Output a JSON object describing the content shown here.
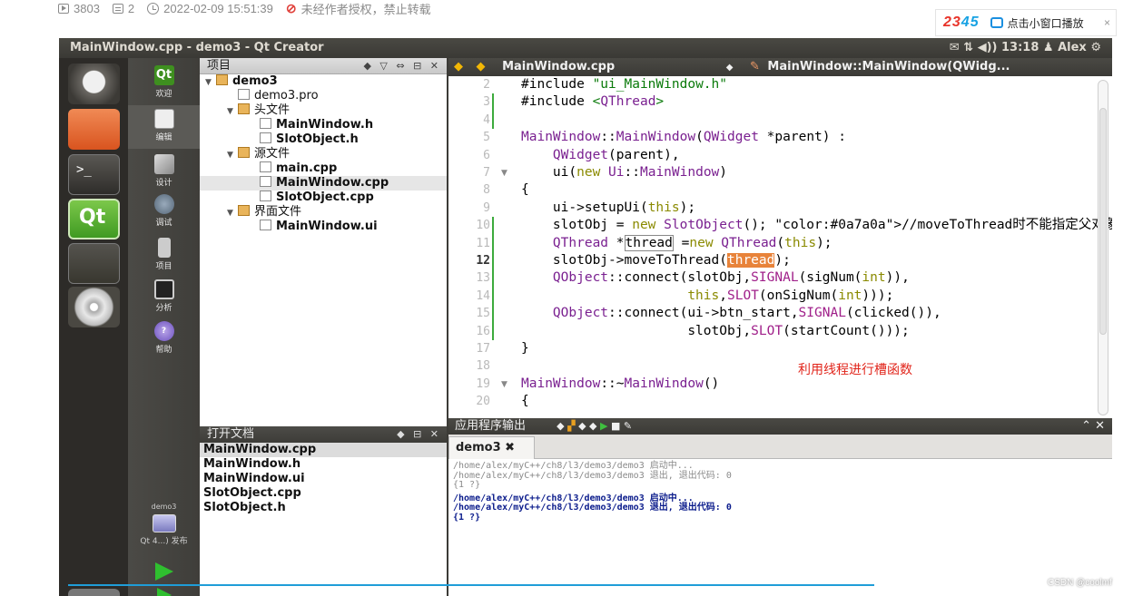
{
  "meta": {
    "views": "3803",
    "comments": "2",
    "datetime": "2022-02-09 15:51:39",
    "notice": "未经作者授权，禁止转载"
  },
  "ad": {
    "brand_a": "23",
    "brand_b": "45",
    "label": "点击小窗口播放",
    "close": "×"
  },
  "window": {
    "title": "MainWindow.cpp - demo3 - Qt Creator",
    "indicators": "✉ ⇅ ◀)) 13:18 ♟ Alex ⚙"
  },
  "sidebar": {
    "items": [
      {
        "label": "欢迎"
      },
      {
        "label": "编辑"
      },
      {
        "label": "设计"
      },
      {
        "label": "调试"
      },
      {
        "label": "项目"
      },
      {
        "label": "分析"
      },
      {
        "label": "帮助"
      }
    ],
    "kit": "demo3",
    "kit_target": "Qt 4...) 发布"
  },
  "project": {
    "header": "项目",
    "tree": [
      {
        "text": "demo3",
        "bold": true,
        "indent": 0,
        "arrow": "▼"
      },
      {
        "text": "demo3.pro",
        "indent": 1
      },
      {
        "text": "头文件",
        "indent": 1,
        "arrow": "▼"
      },
      {
        "text": "MainWindow.h",
        "indent": 2
      },
      {
        "text": "SlotObject.h",
        "indent": 2
      },
      {
        "text": "源文件",
        "indent": 1,
        "arrow": "▼"
      },
      {
        "text": "main.cpp",
        "indent": 2
      },
      {
        "text": "MainWindow.cpp",
        "indent": 2,
        "selected": true
      },
      {
        "text": "SlotObject.cpp",
        "indent": 2
      },
      {
        "text": "界面文件",
        "indent": 1,
        "arrow": "▼"
      },
      {
        "text": "MainWindow.ui",
        "indent": 2
      }
    ]
  },
  "open_docs": {
    "header": "打开文档",
    "files": [
      "MainWindow.cpp",
      "MainWindow.h",
      "MainWindow.ui",
      "SlotObject.cpp",
      "SlotObject.h"
    ]
  },
  "editor": {
    "file": "MainWindow.cpp",
    "symbol": "MainWindow::MainWindow(QWidg...",
    "lines": [
      {
        "n": "2",
        "t": "#include \"ui_MainWindow.h\""
      },
      {
        "n": "3",
        "t": "#include <QThread>"
      },
      {
        "n": "4",
        "t": ""
      },
      {
        "n": "5",
        "t": "MainWindow::MainWindow(QWidget *parent) :"
      },
      {
        "n": "6",
        "t": "    QWidget(parent),"
      },
      {
        "n": "7",
        "t": "    ui(new Ui::MainWindow)"
      },
      {
        "n": "8",
        "t": "{"
      },
      {
        "n": "9",
        "t": "    ui->setupUi(this);"
      },
      {
        "n": "10",
        "t": "    slotObj = new SlotObject(); //moveToThread时不能指定父对象"
      },
      {
        "n": "11",
        "t": "    QThread *thread =new QThread(this);"
      },
      {
        "n": "12",
        "t": "    slotObj->moveToThread(thread);"
      },
      {
        "n": "13",
        "t": "    QObject::connect(slotObj,SIGNAL(sigNum(int)),"
      },
      {
        "n": "14",
        "t": "                     this,SLOT(onSigNum(int)));"
      },
      {
        "n": "15",
        "t": "    QObject::connect(ui->btn_start,SIGNAL(clicked()),"
      },
      {
        "n": "16",
        "t": "                     slotObj,SLOT(startCount()));"
      },
      {
        "n": "17",
        "t": "}"
      },
      {
        "n": "18",
        "t": ""
      },
      {
        "n": "19",
        "t": "MainWindow::~MainWindow()"
      },
      {
        "n": "20",
        "t": "{"
      }
    ],
    "annotation": "利用线程进行槽函数"
  },
  "output": {
    "header": "应用程序输出",
    "tab": "demo3 ✖",
    "lines": [
      {
        "t": "/home/alex/myC++/ch8/l3/demo3/demo3 启动中...",
        "style": "g"
      },
      {
        "t": "/home/alex/myC++/ch8/l3/demo3/demo3 退出, 退出代码: 0",
        "style": "g"
      },
      {
        "t": "{1 ?}",
        "style": "g"
      },
      {
        "t": "/home/alex/myC++/ch8/l3/demo3/demo3 启动中...",
        "style": "b"
      },
      {
        "t": "/home/alex/myC++/ch8/l3/demo3/demo3 退出, 退出代码: 0",
        "style": "b"
      },
      {
        "t": "{1 ?}",
        "style": "b"
      }
    ]
  },
  "watermark": "CSDN @coolmf"
}
